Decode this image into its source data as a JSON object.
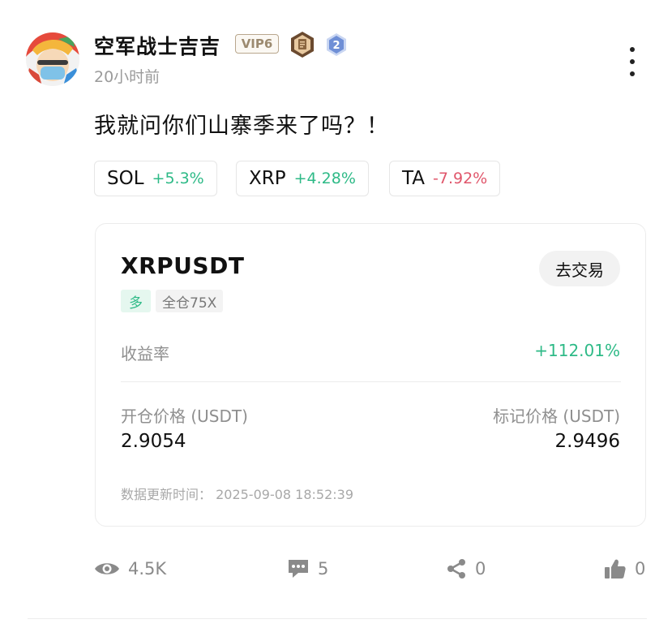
{
  "post": {
    "author": "空军战士吉吉",
    "vip_label": "VIP6",
    "level_badge": "2",
    "time": "20小时前",
    "text": "我就问你们山寨季来了吗？！"
  },
  "tickers": [
    {
      "symbol": "SOL",
      "change": "+5.3%",
      "direction": "up"
    },
    {
      "symbol": "XRP",
      "change": "+4.28%",
      "direction": "up"
    },
    {
      "symbol": "TA",
      "change": "-7.92%",
      "direction": "down"
    }
  ],
  "position_card": {
    "pair": "XRPUSDT",
    "trade_button": "去交易",
    "side": "多",
    "margin_mode": "全仓75X",
    "roi_label": "收益率",
    "roi_value": "+112.01%",
    "open_price_label": "开仓价格 (USDT)",
    "open_price": "2.9054",
    "mark_price_label": "标记价格 (USDT)",
    "mark_price": "2.9496",
    "update_time": "数据更新时间：  2025-09-08 18:52:39"
  },
  "stats": {
    "views": "4.5K",
    "comments": "5",
    "shares": "0",
    "likes": "0"
  },
  "colors": {
    "up": "#2eba87",
    "down": "#e0566b",
    "vip_border": "#b9a78e",
    "level_badge": "#6f8fd6"
  },
  "icons": [
    "more-vertical-icon",
    "eye-icon",
    "comment-icon",
    "share-icon",
    "thumbs-up-icon",
    "medal-icon",
    "level-badge-icon"
  ]
}
